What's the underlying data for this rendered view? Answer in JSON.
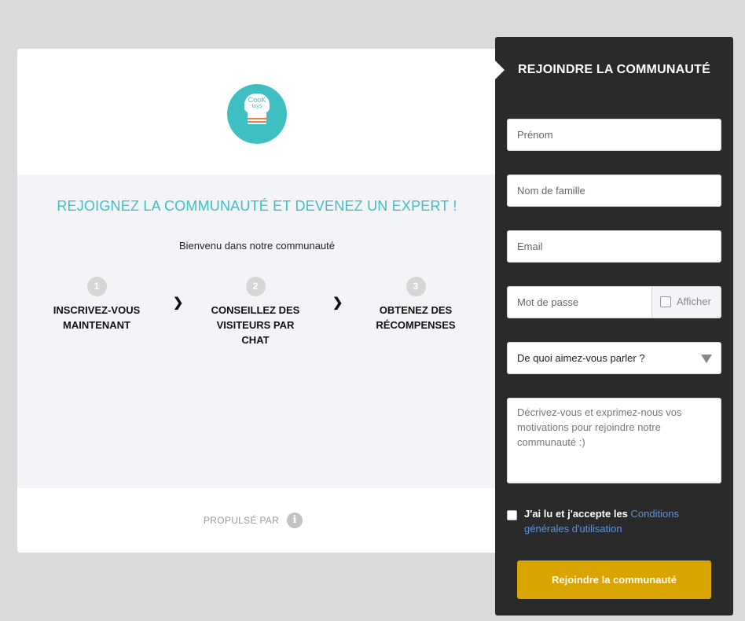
{
  "left": {
    "logo": {
      "line1": "CooK",
      "line2": "toys"
    },
    "headline": "REJOIGNEZ LA COMMUNAUTÉ ET DEVENEZ UN EXPERT !",
    "welcome": "Bienvenu dans notre communauté",
    "steps": [
      {
        "num": "1",
        "label": "INSCRIVEZ-VOUS MAINTENANT"
      },
      {
        "num": "2",
        "label": "CONSEILLEZ DES VISITEURS PAR CHAT"
      },
      {
        "num": "3",
        "label": "OBTENEZ DES RÉCOMPENSES"
      }
    ],
    "powered_by": "PROPULSÉ PAR",
    "powered_icon": "i"
  },
  "panel": {
    "title": "REJOINDRE LA COMMUNAUTÉ",
    "first_name_placeholder": "Prénom",
    "last_name_placeholder": "Nom de famille",
    "email_placeholder": "Email",
    "password_placeholder": "Mot de passe",
    "show_password_label": "Afficher",
    "topic_select": "De quoi aimez-vous parler ?",
    "motivation_placeholder": "Décrivez-vous et exprimez-nous vos motivations pour rejoindre notre communauté :)",
    "terms_text": "J'ai lu et j'accepte les ",
    "terms_link": "Conditions générales d'utilisation",
    "submit_label": "Rejoindre la communauté"
  },
  "colors": {
    "accent": "#3fbfc2",
    "panel_bg": "#2a2a2a",
    "submit_bg": "#d9a300",
    "link": "#5a94e0"
  }
}
